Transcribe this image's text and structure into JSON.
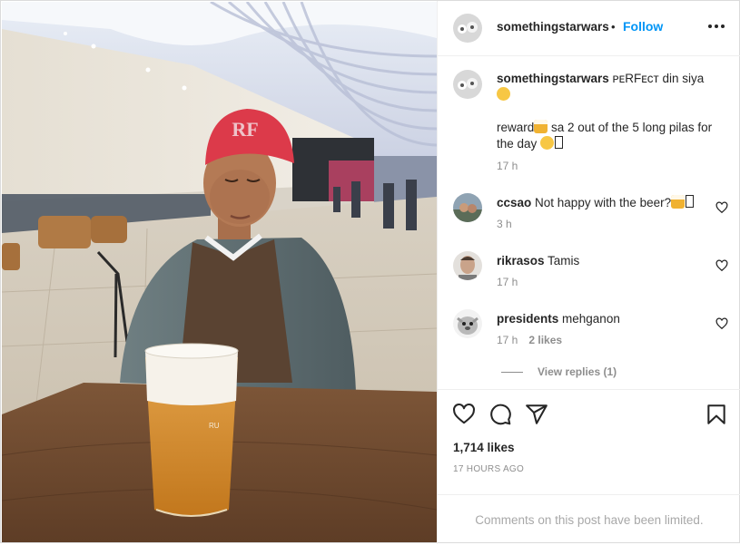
{
  "post": {
    "author": "somethingstarwars",
    "dot": "•",
    "follow_label": "Follow",
    "more_icon": "more-horizontal-icon",
    "photo_alt": ""
  },
  "caption": {
    "username": "somethingstarwars",
    "line1_text": " ᴘᴇRFᴇᴄᴛ din siya ",
    "line2_a": "reward",
    "line2_b": " sa 2 out of the 5 long pilas for the day ",
    "time": "17 h"
  },
  "comments": [
    {
      "username": "ccsao",
      "text": " Not happy with the beer?",
      "time": "3 h",
      "likes": ""
    },
    {
      "username": "rikrasos",
      "text": " Tamis",
      "time": "17 h",
      "likes": ""
    },
    {
      "username": "presidents",
      "text": " mehganon",
      "time": "17 h",
      "likes": "2 likes"
    }
  ],
  "view_replies": "View replies (1)",
  "actions": {
    "like_icon": "heart-icon",
    "comment_icon": "comment-icon",
    "share_icon": "share-icon",
    "save_icon": "bookmark-icon"
  },
  "likes_count": "1,714 likes",
  "posted_ago": "17 HOURS AGO",
  "comments_limited": "Comments on this post have been limited.",
  "colors": {
    "follow": "#0095f6",
    "muted": "#8e8e8e",
    "border": "#efefef"
  }
}
